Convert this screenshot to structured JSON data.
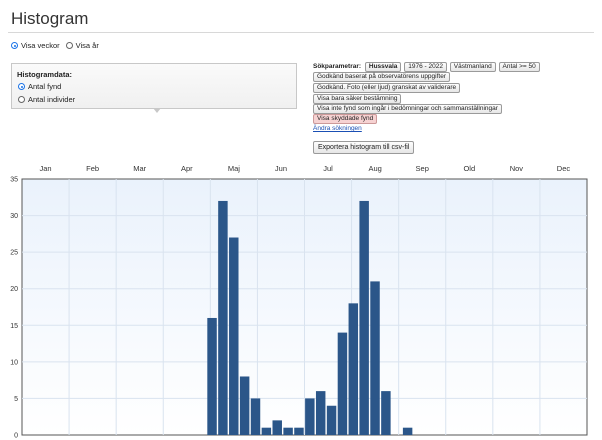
{
  "page": {
    "title": "Histogram"
  },
  "view_mode": {
    "options": [
      {
        "label": "Visa veckor",
        "checked": true
      },
      {
        "label": "Visa år",
        "checked": false
      }
    ]
  },
  "histogram_panel": {
    "title": "Histogramdata:",
    "options": [
      {
        "label": "Antal fynd",
        "checked": true
      },
      {
        "label": "Antal individer",
        "checked": false
      }
    ]
  },
  "search_params": {
    "label": "Sökparametrar:",
    "tags": [
      {
        "text": "Hussvala",
        "style": "bold"
      },
      {
        "text": "1976 - 2022",
        "style": "normal"
      },
      {
        "text": "Västmanland",
        "style": "normal"
      },
      {
        "text": "Antal >= 50",
        "style": "normal"
      },
      {
        "text": "Godkänd baserat på observatörens uppgifter",
        "style": "normal"
      },
      {
        "text": "Godkänd. Foto (eller ljud) granskat av validerare",
        "style": "normal"
      },
      {
        "text": "Visa bara säker bestämning",
        "style": "normal"
      },
      {
        "text": "Visa inte fynd som ingår i bedömningar och sammanställningar",
        "style": "normal"
      },
      {
        "text": "Visa skyddade fynd",
        "style": "warn"
      }
    ],
    "change_link": "Ändra sökningen"
  },
  "export_button": "Exportera histogram till csv-fil",
  "colors": {
    "bar": "#2b5689",
    "accent": "#1a73e8",
    "warn_tag": "#f6d2d2"
  },
  "chart_data": {
    "type": "bar",
    "months": [
      "Jan",
      "Feb",
      "Mar",
      "Apr",
      "Maj",
      "Jun",
      "Jul",
      "Aug",
      "Sep",
      "Old",
      "Nov",
      "Dec"
    ],
    "y_ticks": [
      "35",
      "30",
      "25",
      "20",
      "15",
      "10",
      "5",
      "0"
    ],
    "ylim": [
      0,
      35
    ],
    "weeks": [
      18,
      19,
      20,
      21,
      22,
      23,
      24,
      25,
      26,
      27,
      28,
      29,
      30,
      31,
      32,
      33,
      34,
      35,
      36,
      37,
      38
    ],
    "values": [
      16,
      32,
      27,
      8,
      5,
      1,
      2,
      1,
      1,
      5,
      6,
      4,
      14,
      18,
      32,
      21,
      6,
      0,
      1,
      0,
      0
    ],
    "grid": true
  }
}
